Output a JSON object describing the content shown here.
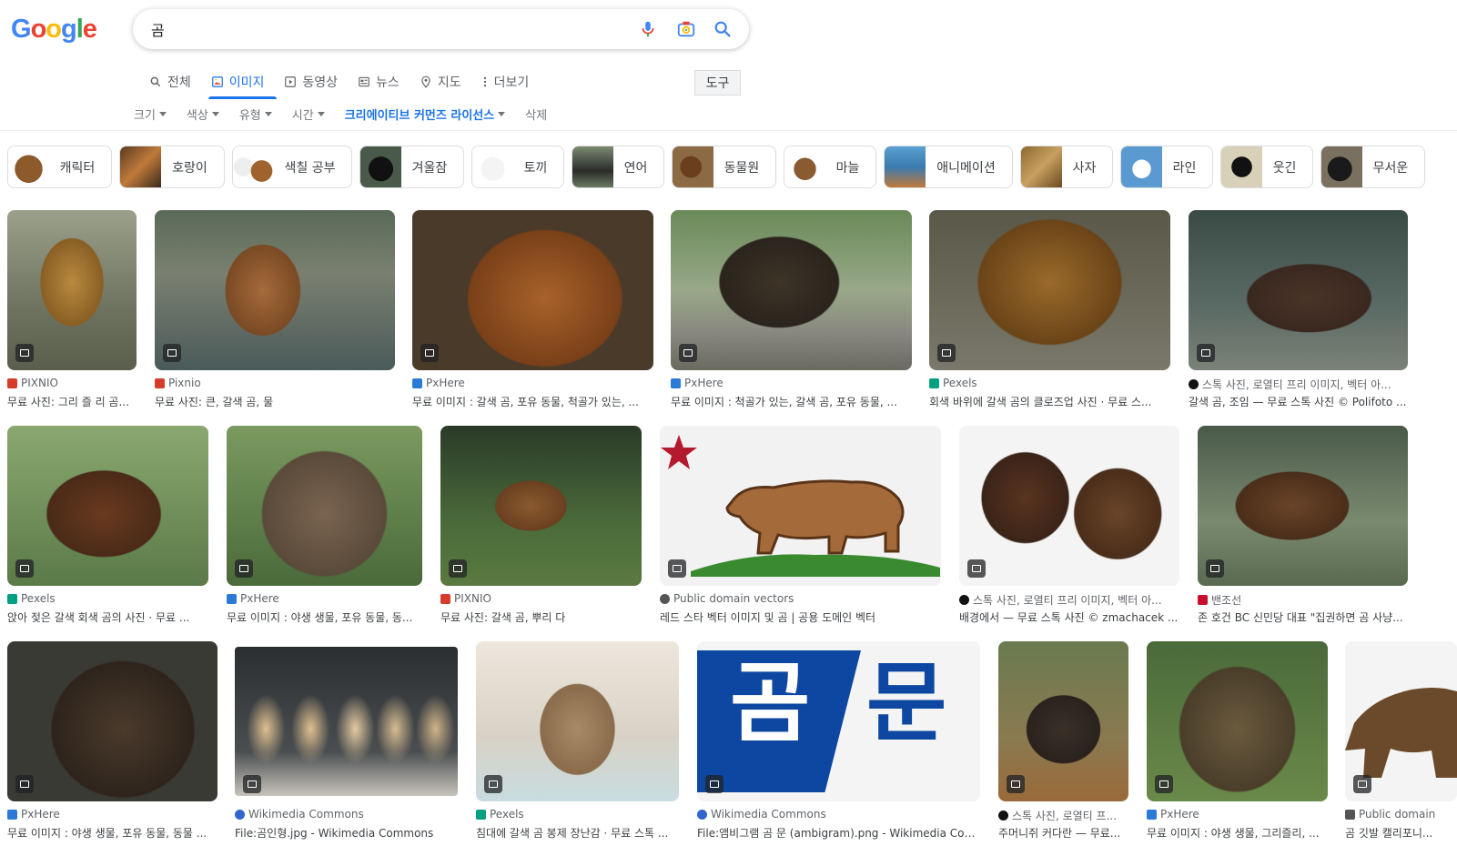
{
  "logo": "Google",
  "search": {
    "query": "곰"
  },
  "tabs": [
    {
      "label": "전체",
      "icon": "search-icon"
    },
    {
      "label": "이미지",
      "icon": "image-icon"
    },
    {
      "label": "동영상",
      "icon": "video-icon"
    },
    {
      "label": "뉴스",
      "icon": "news-icon"
    },
    {
      "label": "지도",
      "icon": "map-pin-icon"
    },
    {
      "label": "더보기",
      "icon": "more-vert-icon"
    }
  ],
  "tools_label": "도구",
  "filters": [
    {
      "label": "크기"
    },
    {
      "label": "색상"
    },
    {
      "label": "유형"
    },
    {
      "label": "시간"
    },
    {
      "label": "크리에이티브 커먼즈 라이선스"
    },
    {
      "label": "삭제"
    }
  ],
  "chips": [
    {
      "label": "캐릭터"
    },
    {
      "label": "호랑이"
    },
    {
      "label": "색칠 공부"
    },
    {
      "label": "겨울잠"
    },
    {
      "label": "토끼"
    },
    {
      "label": "연어"
    },
    {
      "label": "동물원"
    },
    {
      "label": "마늘"
    },
    {
      "label": "애니메이션"
    },
    {
      "label": "사자"
    },
    {
      "label": "라인"
    },
    {
      "label": "웃긴"
    },
    {
      "label": "무서운"
    }
  ],
  "results": [
    {
      "source": "PIXNIO",
      "title": "무료 사진: 그리 즐 리 곰..."
    },
    {
      "source": "Pixnio",
      "title": "무료 사진: 큰, 갈색 곰, 물"
    },
    {
      "source": "PxHere",
      "title": "무료 이미지 : 갈색 곰, 포유 동물, 척골가 있는, ..."
    },
    {
      "source": "PxHere",
      "title": "무료 이미지 : 척골가 있는, 갈색 곰, 포유 동물, ..."
    },
    {
      "source": "Pexels",
      "title": "회색 바위에 갈색 곰의 클로즈업 사진 · 무료 스..."
    },
    {
      "source": "스톡 사진, 로열티 프리 이미지, 벡터 아...",
      "title": "갈색 곰, 조임 — 무료 스톡 사진 © Polifoto ..."
    },
    {
      "source": "Pexels",
      "title": "앉아 젖은 갈색 회색 곰의 사진 · 무료 ..."
    },
    {
      "source": "PxHere",
      "title": "무료 이미지 : 야생 생물, 포유 동물, 동..."
    },
    {
      "source": "PIXNIO",
      "title": "무료 사진: 갈색 곰, 뿌리 다"
    },
    {
      "source": "Public domain vectors",
      "title": "레드 스타 벡터 이미지 및 곰 | 공용 도메인 벡터"
    },
    {
      "source": "스톡 사진, 로열티 프리 이미지, 벡터 아...",
      "title": "배경에서 — 무료 스톡 사진 © zmachacek ..."
    },
    {
      "source": "밴조선",
      "title": "존 호건 BC 신민당 대표 \"집권하면 곰 사냥..."
    },
    {
      "source": "PxHere",
      "title": "무료 이미지 : 야생 생물, 포유 동물, 동물 ..."
    },
    {
      "source": "Wikimedia Commons",
      "title": "File:곰인형.jpg - Wikimedia Commons"
    },
    {
      "source": "Pexels",
      "title": "침대에 갈색 곰 봉제 장난감 · 무료 스톡 ..."
    },
    {
      "source": "Wikimedia Commons",
      "title": "File:앰비그램 곰 문 (ambigram).png - Wikimedia Comm..."
    },
    {
      "source": "스톡 사진, 로열티 프...",
      "title": "주머니쥐 커다란 — 무료..."
    },
    {
      "source": "PxHere",
      "title": "무료 이미지 : 야생 생물, 그리즐리, ..."
    },
    {
      "source": "Public domain",
      "title": "곰 깃발 캘리포니..."
    }
  ],
  "ambigram": {
    "left": "곰",
    "right": "문"
  },
  "colors": {
    "accent": "#1a73e8",
    "flag_star": "#b41a2e",
    "ambigram_blue": "#0d47a1"
  }
}
